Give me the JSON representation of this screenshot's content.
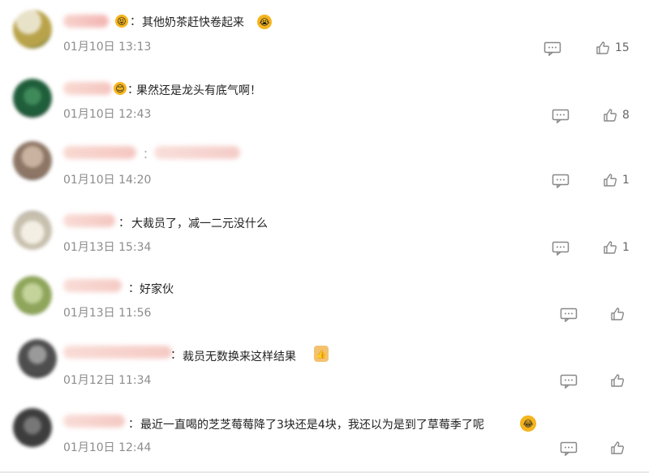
{
  "comments": [
    {
      "name": "…国群虎",
      "separator": "：",
      "text": "其他奶茶赶快卷起来",
      "time": "01月10日 13:13",
      "likes": "15",
      "lead_emoji": "party-face",
      "trail_emoji": "crying-face"
    },
    {
      "name": "…",
      "separator": "：",
      "text": "果然还是龙头有底气啊！",
      "time": "01月10日 12:43",
      "likes": "8",
      "lead_emoji": "smile-face"
    },
    {
      "name": "…点啊",
      "separator": "：",
      "text": "…吧",
      "time": "01月10日 14:20",
      "likes": "1"
    },
    {
      "name": "…毛",
      "separator": "：",
      "text": "大裁员了，减一二元没什么",
      "time": "01月13日 15:34",
      "likes": "1"
    },
    {
      "name": "…",
      "separator": "：",
      "text": "好家伙",
      "time": "01月13日 11:56",
      "likes": ""
    },
    {
      "name": "…上清心",
      "separator": "：",
      "text": "裁员无数换来这样结果",
      "time": "01月12日 11:34",
      "likes": "",
      "trail_emoji": "thumbs-up"
    },
    {
      "name": "…朋友",
      "separator": "：",
      "text": "最近一直喝的芝芝莓莓降了3块还是4块，我还以为是到了草莓季了呢",
      "time": "01月10日 12:44",
      "likes": "",
      "trail_emoji": "laughing-crying-face"
    }
  ],
  "colors": {
    "time": "#8c8c8c",
    "text": "#222222",
    "icon": "#888888",
    "emoji": "#f5b41e"
  }
}
